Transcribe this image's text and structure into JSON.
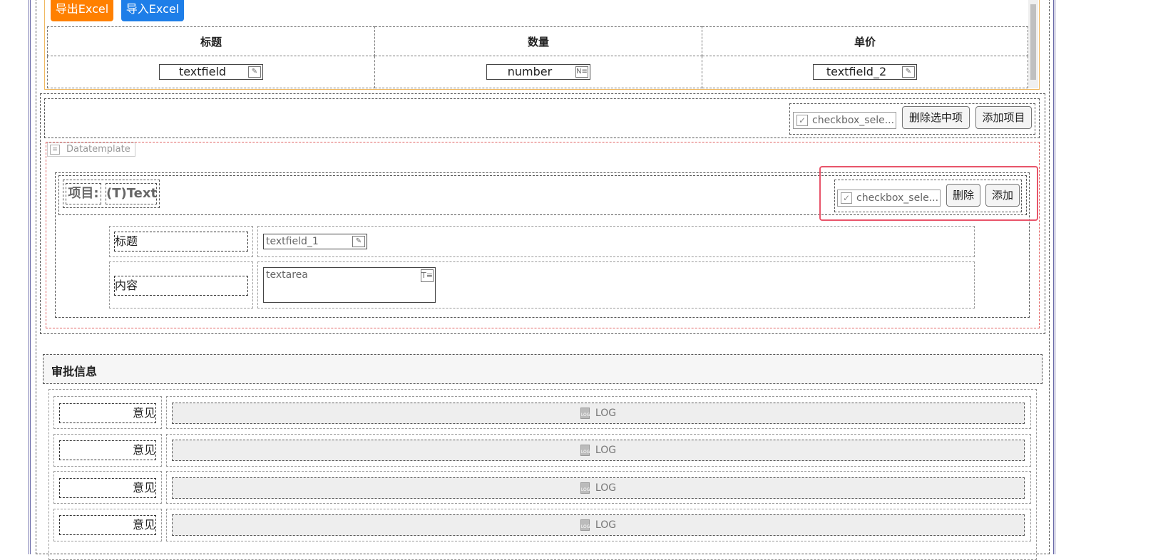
{
  "toolbar": {
    "export_label": "导出Excel",
    "import_label": "导入Excel",
    "export_color": "#ff8000",
    "import_color": "#1e7ee8"
  },
  "table": {
    "headers": [
      "标题",
      "数量",
      "单价"
    ],
    "fields": [
      "textfield",
      "number",
      "textfield_2"
    ],
    "field_icons": [
      "edit-icon",
      "number-icon",
      "edit-icon"
    ]
  },
  "list_actions": {
    "checkbox_label": "checkbox_sele...",
    "delete_selected": "删除选中项",
    "add_item": "添加项目"
  },
  "datatemplate": {
    "label": "Datatemplate",
    "item_prefix": "项目:",
    "item_text": "(T)Text",
    "checkbox_label": "checkbox_sele...",
    "delete_label": "删除",
    "add_label": "添加",
    "highlight_color": "#e8546a",
    "rows": [
      {
        "label": "标题",
        "field": "textfield_1"
      },
      {
        "label": "内容",
        "field": "textarea"
      }
    ]
  },
  "approval": {
    "title": "审批信息",
    "rows": [
      {
        "label": "意见",
        "value": "LOG"
      },
      {
        "label": "意见",
        "value": "LOG"
      },
      {
        "label": "意见",
        "value": "LOG"
      },
      {
        "label": "意见",
        "value": "LOG"
      }
    ]
  }
}
